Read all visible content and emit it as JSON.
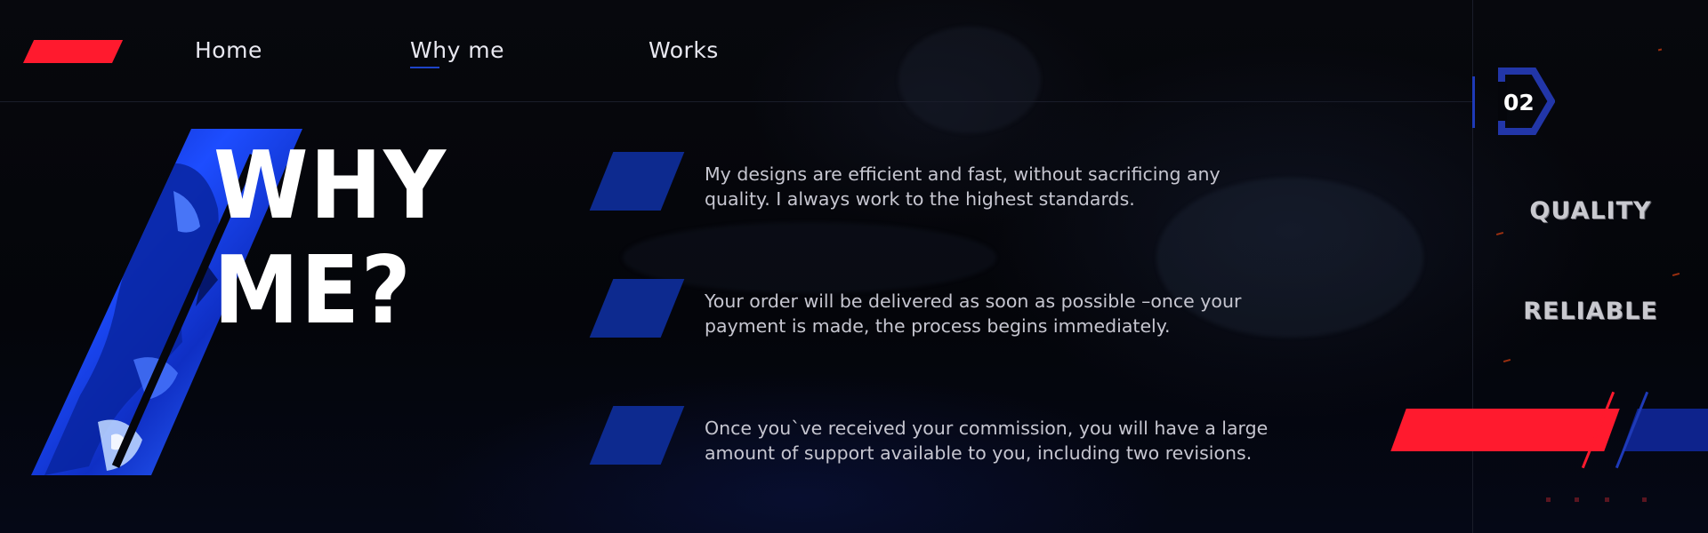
{
  "nav": {
    "items": [
      {
        "label": "Home"
      },
      {
        "label": "Why me"
      },
      {
        "label": "Works"
      }
    ],
    "active_index": 1
  },
  "hero": {
    "title": "WHY\nME?"
  },
  "features": [
    {
      "text": "My designs are efficient and fast, without sacrificing any quality. I always work to the highest standards."
    },
    {
      "text": "Your order will be delivered as soon as possible –once your payment is made, the process begins immediately."
    },
    {
      "text": "Once you`ve received your commission, you will have a large amount of support available to you, including two revisions."
    }
  ],
  "rail": {
    "slide_number": "02",
    "labels": [
      "QUALITY",
      "RELIABLE"
    ]
  },
  "colors": {
    "accent_red": "#ff1a2e",
    "accent_blue": "#0d2a8f",
    "indicator_blue": "#2236a8",
    "background": "#05060b",
    "text": "#c6c6d0"
  },
  "icons": {
    "logo": "red-parallelogram-logo",
    "slide_indicator": "chevron-outline-icon"
  }
}
